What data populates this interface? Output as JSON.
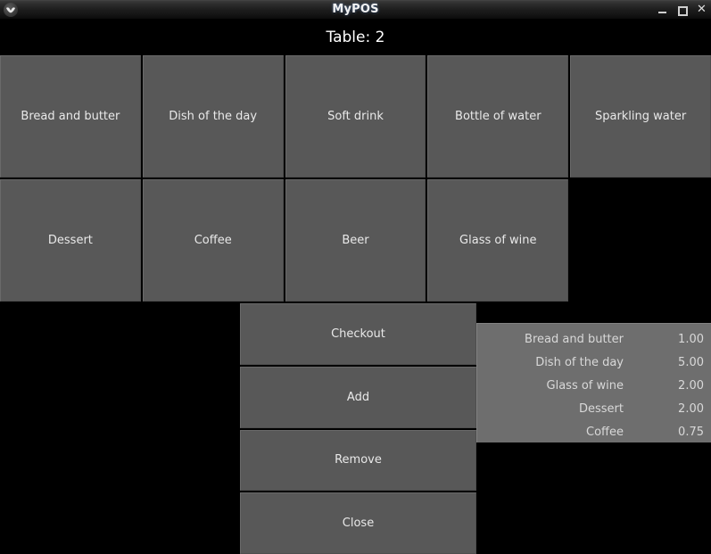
{
  "window": {
    "title": "MyPOS",
    "icon": "app-logo-icon",
    "controls": {
      "minimize": "_",
      "maximize": "□",
      "close": "✕"
    }
  },
  "header": {
    "table_label": "Table: 2"
  },
  "products": {
    "columns": 5,
    "rows": 2,
    "items": [
      {
        "label": "Bread and butter"
      },
      {
        "label": "Dish of the day"
      },
      {
        "label": "Soft drink"
      },
      {
        "label": "Bottle of water"
      },
      {
        "label": "Sparkling water"
      },
      {
        "label": "Dessert"
      },
      {
        "label": "Coffee"
      },
      {
        "label": "Beer"
      },
      {
        "label": "Glass of wine"
      }
    ]
  },
  "actions": [
    {
      "label": "Checkout",
      "name": "checkout-button"
    },
    {
      "label": "Add",
      "name": "add-button"
    },
    {
      "label": "Remove",
      "name": "remove-button"
    },
    {
      "label": "Close",
      "name": "close-button"
    }
  ],
  "order": {
    "lines": [
      {
        "name": "Bread and butter",
        "price": "1.00"
      },
      {
        "name": "Dish of the day",
        "price": "5.00"
      },
      {
        "name": "Glass of wine",
        "price": "2.00"
      },
      {
        "name": "Dessert",
        "price": "2.00"
      },
      {
        "name": "Coffee",
        "price": "0.75"
      }
    ]
  },
  "colors": {
    "background": "#000000",
    "button_face": "#585858",
    "list_face": "#6e6e6e",
    "text": "#e9e9e9",
    "titlebar_text": "#f2f2f2"
  }
}
